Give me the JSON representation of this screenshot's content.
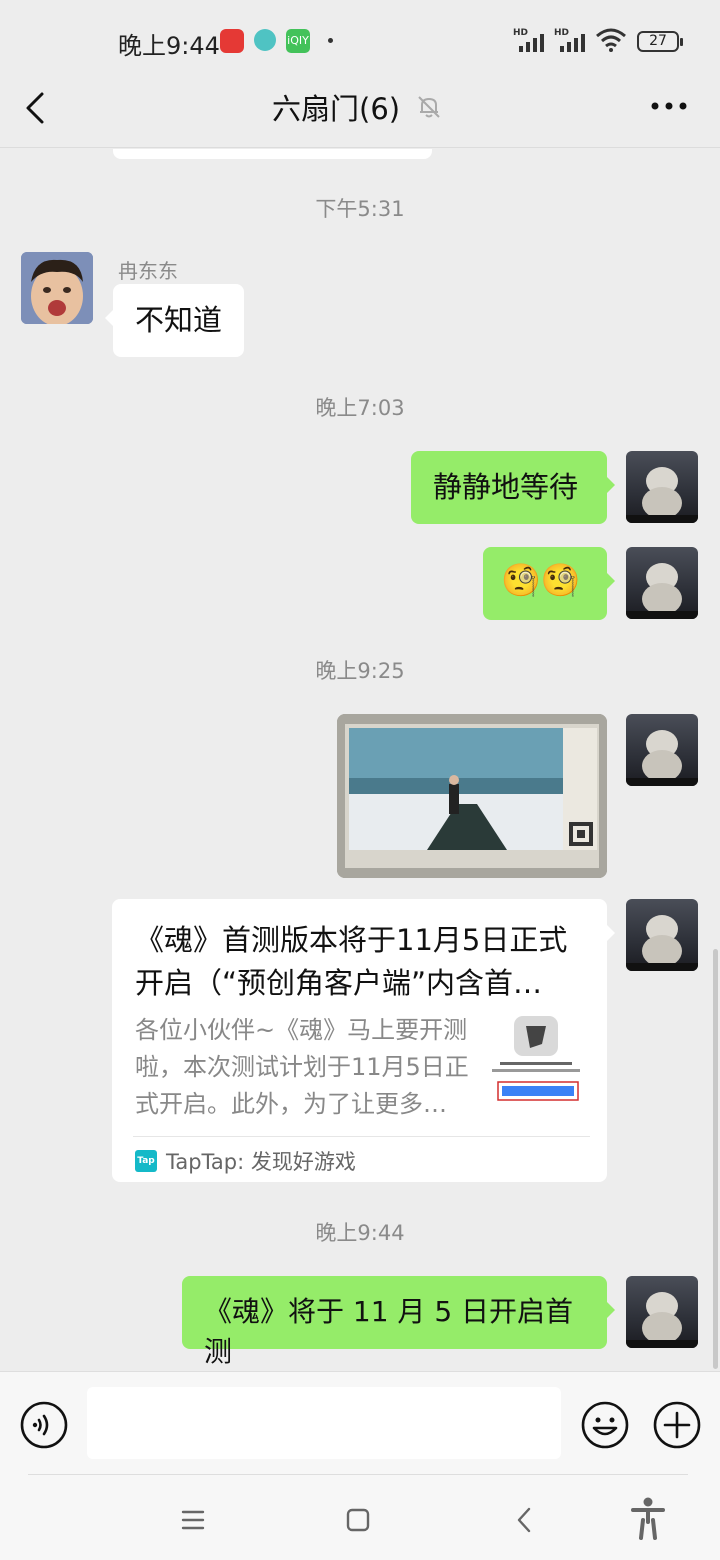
{
  "status_bar": {
    "time": "晚上9:44",
    "signal_1_label": "HD",
    "signal_2_label": "HD",
    "battery": "27",
    "app_icon_iqiyi": "iQIY"
  },
  "header": {
    "title": "六扇门(6)",
    "back_icon": "chevron-left-icon",
    "mute_icon": "bell-off-icon",
    "more_icon": "more-dots-icon"
  },
  "messages": [
    {
      "type": "timestamp",
      "text": "下午5:31"
    },
    {
      "type": "text",
      "side": "left",
      "sender": "冉东东",
      "text": "不知道"
    },
    {
      "type": "timestamp",
      "text": "晚上7:03"
    },
    {
      "type": "text",
      "side": "right",
      "text": "静静地等待"
    },
    {
      "type": "emoji",
      "side": "right",
      "text": "🧐🧐"
    },
    {
      "type": "timestamp",
      "text": "晚上9:25"
    },
    {
      "type": "image",
      "side": "right"
    },
    {
      "type": "link",
      "side": "right",
      "title": "《魂》首测版本将于11月5日正式开启（“预创角客户端”内含首…",
      "description": "各位小伙伴~《魂》马上要开测啦，本次测试计划于11月5日正式开启。此外，为了让更多…",
      "source": "TapTap: 发现好游戏",
      "source_icon_text": "Tap"
    },
    {
      "type": "timestamp",
      "text": "晚上9:44"
    },
    {
      "type": "text",
      "side": "right",
      "text": "《魂》将于 11 月 5 日开启首测"
    }
  ],
  "input_bar": {
    "value": "",
    "voice_icon": "voice-icon",
    "emoji_icon": "emoji-icon",
    "plus_icon": "plus-icon"
  },
  "nav_bar": {
    "menu_icon": "menu-icon",
    "home_icon": "home-square-icon",
    "back_icon": "back-triangle-icon",
    "accessibility_icon": "accessibility-icon"
  },
  "colors": {
    "background": "#ededed",
    "bubble_me": "#95ec69",
    "bubble_other": "#ffffff",
    "timestamp": "#8a8a8a"
  }
}
